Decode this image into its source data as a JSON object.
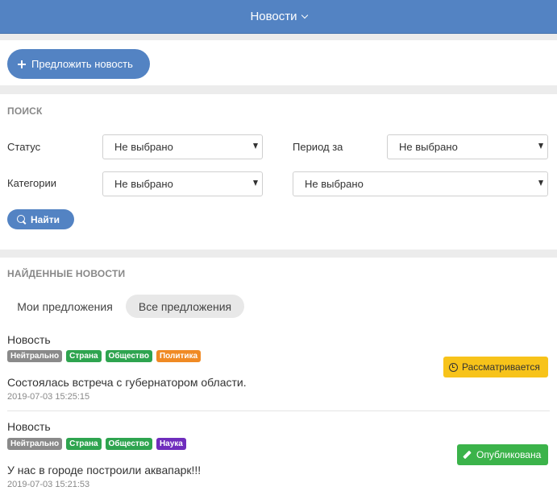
{
  "header": {
    "title": "Новости",
    "chevron_icon": "chevron-down-icon"
  },
  "suggest_button": {
    "label": "Предложить новость",
    "icon": "plus-icon"
  },
  "search": {
    "title": "ПОИСК",
    "status_label": "Статус",
    "status_value": "Не выбрано",
    "period_label": "Период за",
    "period_value": "Не выбрано",
    "categories_label": "Категории",
    "categories_value": "Не выбрано",
    "extra_value": "Не выбрано",
    "find_label": "Найти",
    "find_icon": "search-icon"
  },
  "found": {
    "title": "НАЙДЕННЫЕ НОВОСТИ",
    "tabs": [
      {
        "label": "Мои предложения",
        "active": false
      },
      {
        "label": "Все предложения",
        "active": true
      }
    ],
    "items": [
      {
        "type": "Новость",
        "badges": [
          {
            "label": "Нейтрально",
            "color": "#8a8a8a"
          },
          {
            "label": "Страна",
            "color": "#2ea44f"
          },
          {
            "label": "Общество",
            "color": "#2ea44f"
          },
          {
            "label": "Политика",
            "color": "#f08a24"
          }
        ],
        "text": "Состоялась встреча с губернатором области.",
        "date": "2019-07-03 15:25:15",
        "status": {
          "label": "Рассматривается",
          "bg": "#f7c31a",
          "fg": "#333333",
          "icon": "clock-icon"
        }
      },
      {
        "type": "Новость",
        "badges": [
          {
            "label": "Нейтрально",
            "color": "#8a8a8a"
          },
          {
            "label": "Страна",
            "color": "#2ea44f"
          },
          {
            "label": "Общество",
            "color": "#2ea44f"
          },
          {
            "label": "Наука",
            "color": "#6f2dbd"
          }
        ],
        "text": "У нас в городе построили аквапарк!!!",
        "date": "2019-07-03 15:21:53",
        "status": {
          "label": "Опубликована",
          "bg": "#3bb34a",
          "fg": "#ffffff",
          "icon": "pencil-icon"
        }
      }
    ]
  }
}
